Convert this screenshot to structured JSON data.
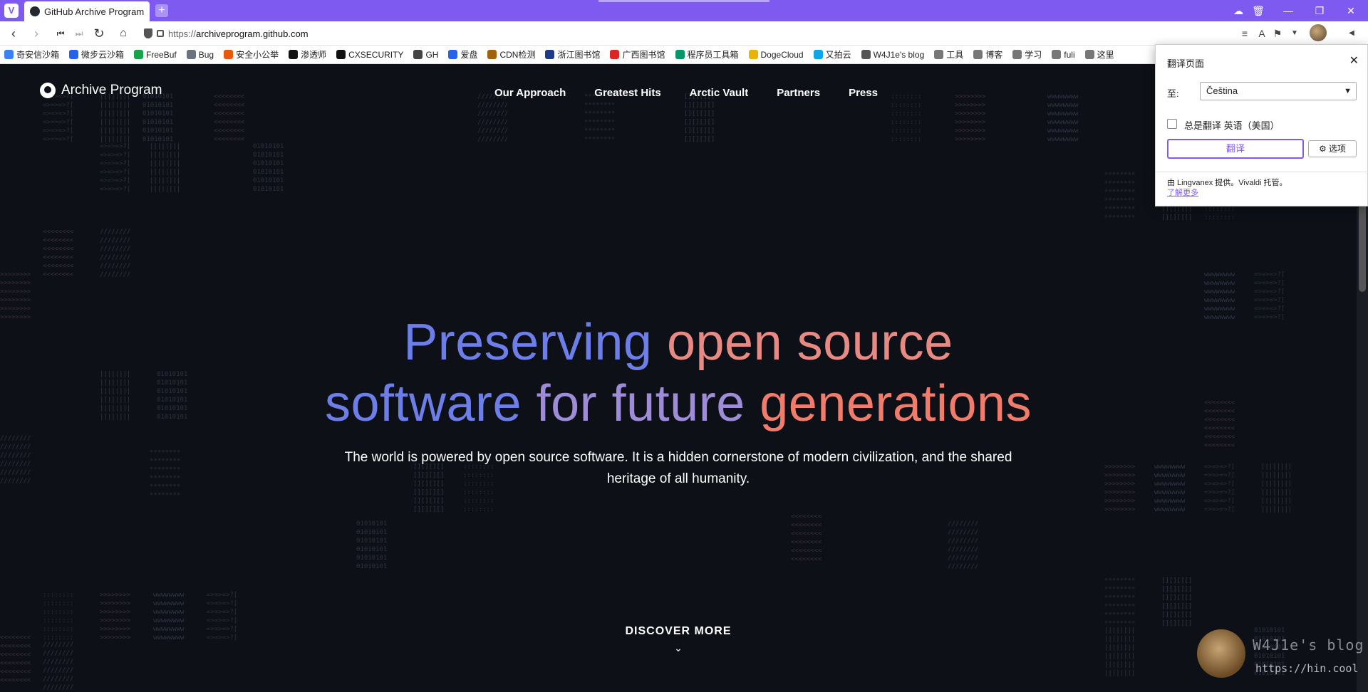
{
  "browser": {
    "tab_title": "GitHub Archive Program | F",
    "new_tab_symbol": "+",
    "url_prefix": "https://",
    "url_host": "archiveprogram.github.com",
    "accent_color": "#7f5af0"
  },
  "bookmarks": [
    {
      "label": "奇安信沙箱",
      "color": "#3b82f6"
    },
    {
      "label": "微步云沙箱",
      "color": "#2563eb"
    },
    {
      "label": "FreeBuf",
      "color": "#16a34a"
    },
    {
      "label": "Bug",
      "color": "#6b7280"
    },
    {
      "label": "安全小公举",
      "color": "#ea580c"
    },
    {
      "label": "渗透师",
      "color": "#111111"
    },
    {
      "label": "CXSECURITY",
      "color": "#111111"
    },
    {
      "label": "GH",
      "color": "#444444"
    },
    {
      "label": "爱盘",
      "color": "#2563eb"
    },
    {
      "label": "CDN检测",
      "color": "#a16207"
    },
    {
      "label": "浙江图书馆",
      "color": "#1e3a8a"
    },
    {
      "label": "广西图书馆",
      "color": "#dc2626"
    },
    {
      "label": "程序员工具箱",
      "color": "#059669"
    },
    {
      "label": "DogeCloud",
      "color": "#eab308"
    },
    {
      "label": "又拍云",
      "color": "#0ea5e9"
    },
    {
      "label": "W4J1e's blog",
      "color": "#555555"
    },
    {
      "label": "工具",
      "color": "#777777"
    },
    {
      "label": "博客",
      "color": "#777777"
    },
    {
      "label": "学习",
      "color": "#777777"
    },
    {
      "label": "fuli",
      "color": "#777777"
    },
    {
      "label": "这里",
      "color": "#777777"
    }
  ],
  "site": {
    "logo_text": "Archive Program",
    "nav": [
      "Our Approach",
      "Greatest Hits",
      "Arctic Vault",
      "Partners",
      "Press"
    ],
    "hero_line1_a": "Preserving",
    "hero_line1_b": "open source",
    "hero_line2_a": "software",
    "hero_line2_b": "for future",
    "hero_line2_c": "generations",
    "hero_sub": "The world is powered by open source software. It is a hidden cornerstone of modern civilization, and the shared heritage of all humanity.",
    "discover": "DISCOVER MORE"
  },
  "translate_popup": {
    "title": "翻译页面",
    "to_label": "至:",
    "language": "Čeština",
    "always_translate": "总是翻译 英语（美国）",
    "translate_button": "翻译",
    "options_button": "选项",
    "footer_text": "由 Lingvanex 提供。Vivaldi 托管。",
    "learn_more": "了解更多"
  },
  "watermark": {
    "title": "W4J1e's blog",
    "url": "https://hin.cool"
  }
}
